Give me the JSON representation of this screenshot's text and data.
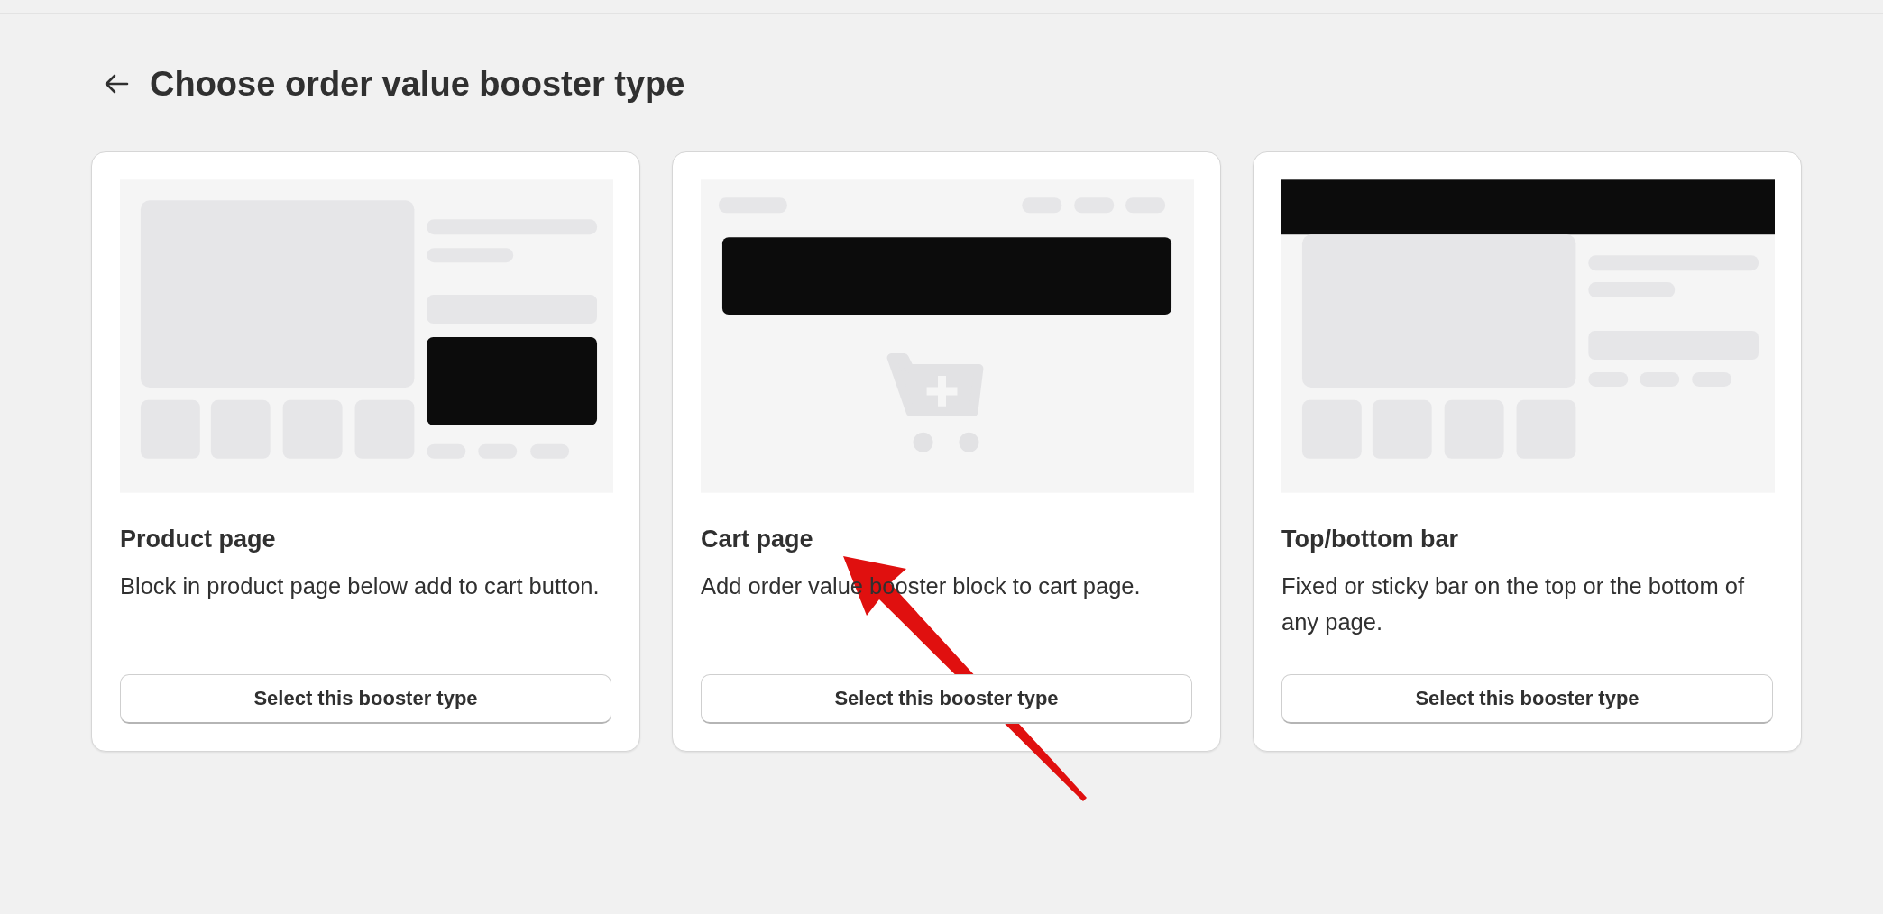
{
  "header": {
    "title": "Choose order value booster type"
  },
  "cards": [
    {
      "preview": {
        "kind": "product"
      },
      "title": "Product page",
      "description": "Block in product page below add to cart button.",
      "button": "Select this booster type"
    },
    {
      "preview": {
        "kind": "cart"
      },
      "title": "Cart page",
      "description": "Add order value booster block to cart page.",
      "button": "Select this booster type"
    },
    {
      "preview": {
        "kind": "bar"
      },
      "title": "Top/bottom bar",
      "description": "Fixed or sticky bar on the top or the bottom of any page.",
      "button": "Select this booster type"
    }
  ]
}
